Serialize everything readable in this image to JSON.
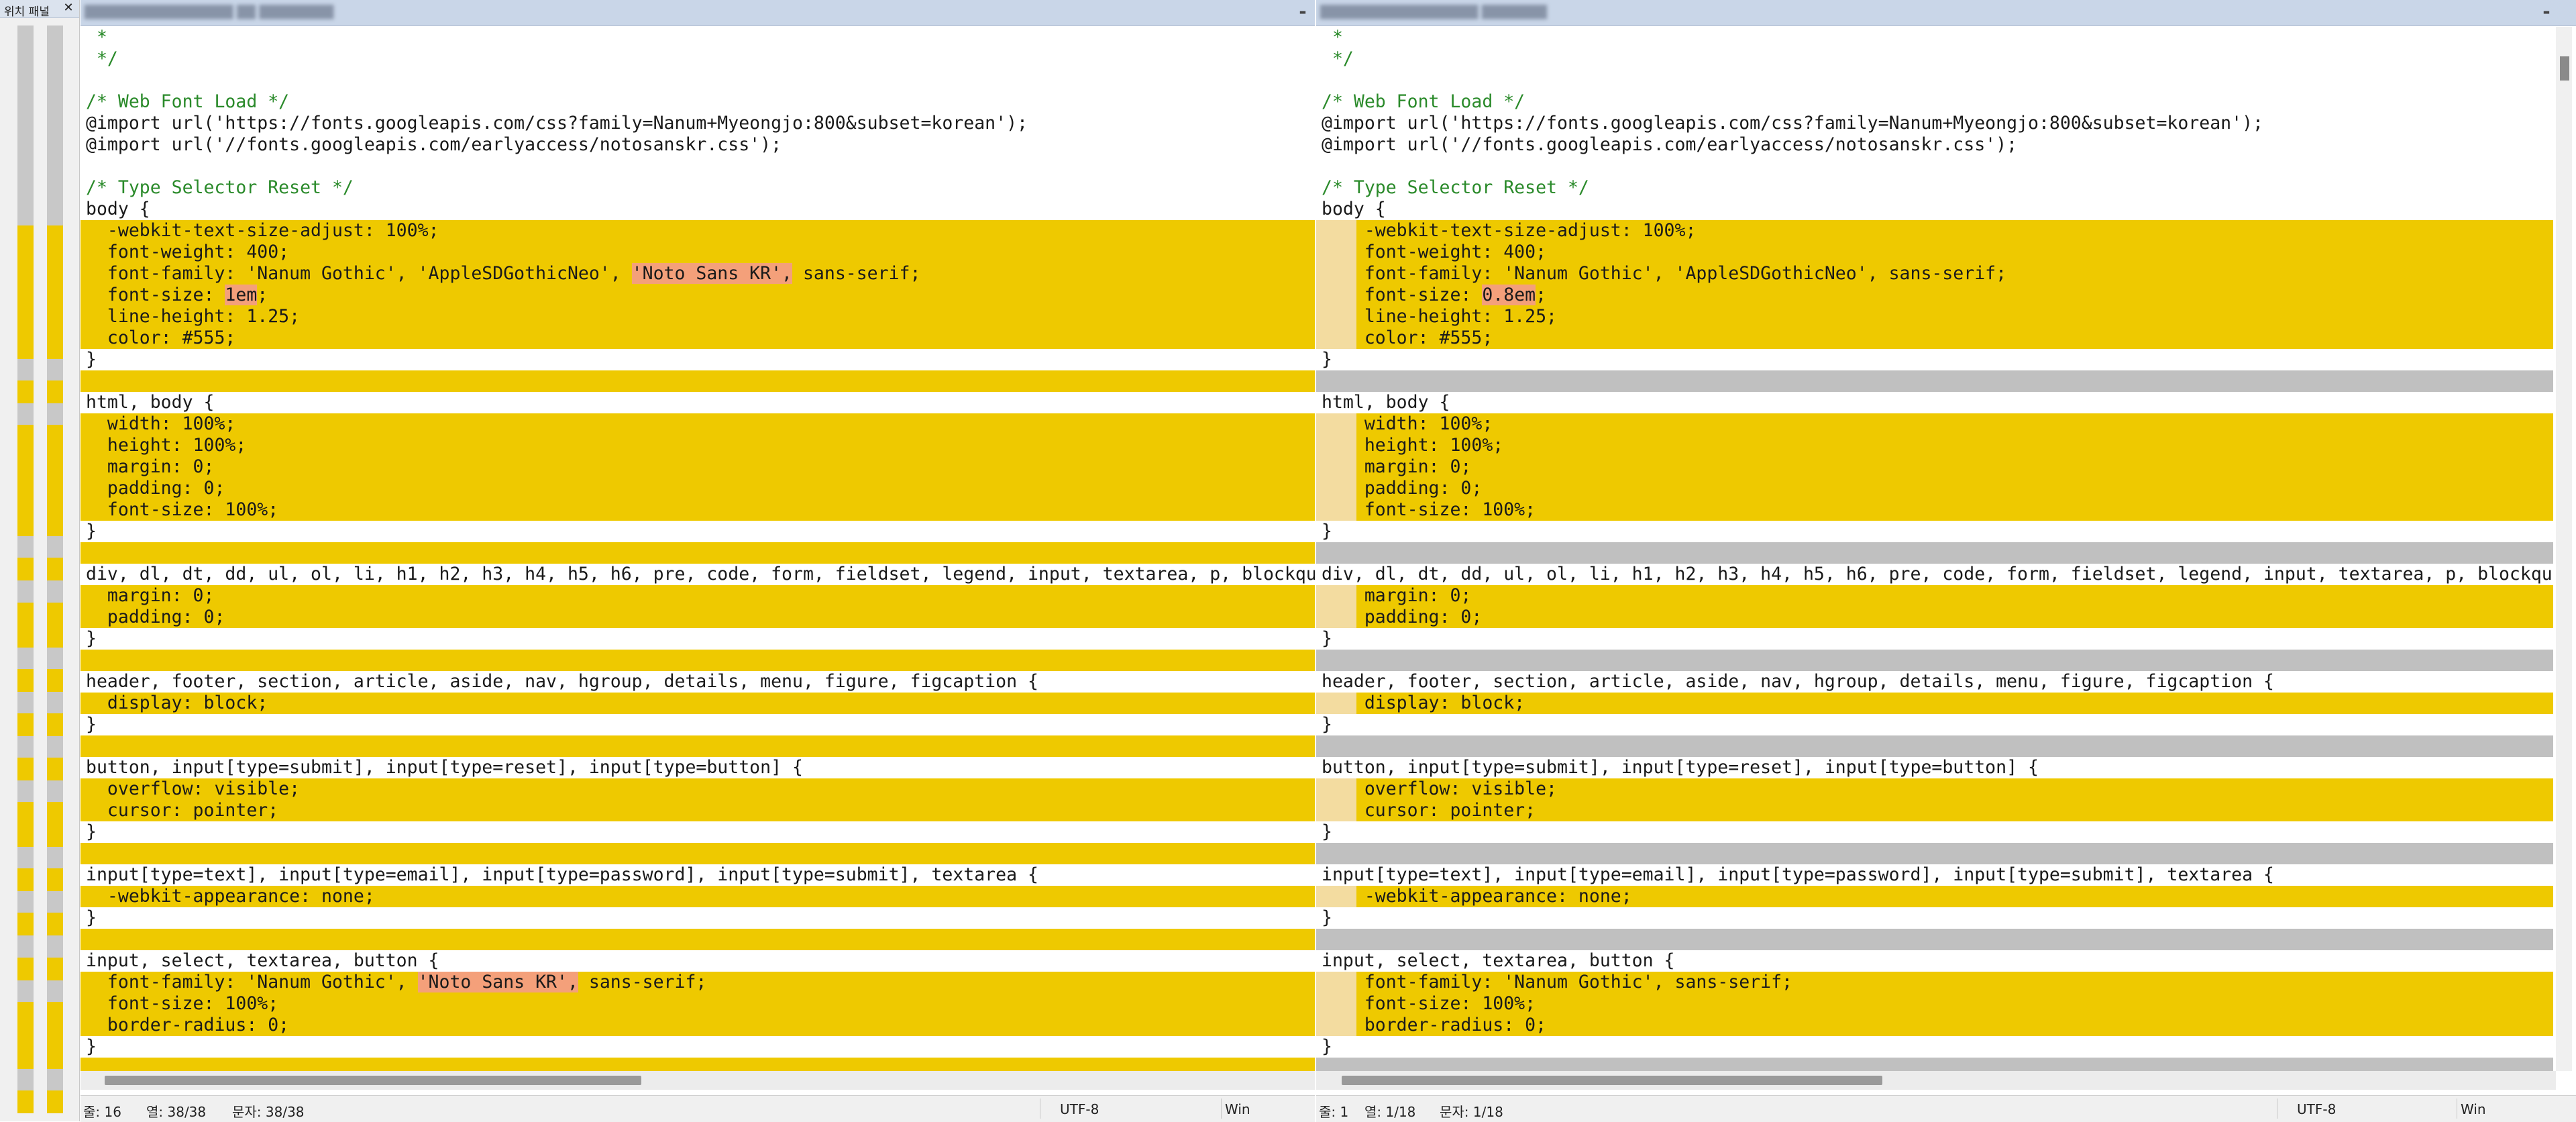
{
  "location_pane": {
    "tab_label": "위치 패널",
    "close_glyph": "✕",
    "mark_color": "#eec900"
  },
  "left_pane": {
    "title": "████████████████ ██ ████████",
    "lines": [
      {
        "type": "ctx",
        "cls": "comment",
        "segs": [
          {
            "t": " *"
          }
        ]
      },
      {
        "type": "ctx",
        "cls": "comment",
        "segs": [
          {
            "t": " */"
          }
        ]
      },
      {
        "type": "ctx",
        "segs": [
          {
            "t": ""
          }
        ]
      },
      {
        "type": "ctx",
        "cls": "comment",
        "segs": [
          {
            "t": "/* Web Font Load */"
          }
        ]
      },
      {
        "type": "ctx",
        "segs": [
          {
            "t": "@import url('https://fonts.googleapis.com/css?family=Nanum+Myeongjo:800&subset=korean');"
          }
        ]
      },
      {
        "type": "ctx",
        "segs": [
          {
            "t": "@import url('//fonts.googleapis.com/earlyaccess/notosanskr.css');"
          }
        ]
      },
      {
        "type": "ctx",
        "segs": [
          {
            "t": ""
          }
        ]
      },
      {
        "type": "ctx",
        "cls": "comment",
        "segs": [
          {
            "t": "/* Type Selector Reset */"
          }
        ]
      },
      {
        "type": "ctx",
        "segs": [
          {
            "t": "body {"
          }
        ]
      },
      {
        "type": "changed",
        "segs": [
          {
            "t": "  -webkit-text-size-adjust: 100%;"
          }
        ]
      },
      {
        "type": "changed",
        "segs": [
          {
            "t": "  font-weight: 400;"
          }
        ]
      },
      {
        "type": "changed",
        "segs": [
          {
            "t": "  font-family: 'Nanum Gothic', 'AppleSDGothicNeo', "
          },
          {
            "t": "'Noto Sans KR',",
            "hl": true
          },
          {
            "t": " sans-serif;"
          }
        ]
      },
      {
        "type": "changed",
        "segs": [
          {
            "t": "  font-size: "
          },
          {
            "t": "1em",
            "hl": true
          },
          {
            "t": ";"
          }
        ]
      },
      {
        "type": "changed",
        "segs": [
          {
            "t": "  line-height: 1.25;"
          }
        ]
      },
      {
        "type": "changed",
        "segs": [
          {
            "t": "  color: #555;"
          }
        ]
      },
      {
        "type": "ctx",
        "segs": [
          {
            "t": "}"
          }
        ]
      },
      {
        "type": "gap",
        "segs": [
          {
            "t": ""
          }
        ]
      },
      {
        "type": "ctx",
        "segs": [
          {
            "t": "html, body {"
          }
        ]
      },
      {
        "type": "changed",
        "segs": [
          {
            "t": "  width: 100%;"
          }
        ]
      },
      {
        "type": "changed",
        "segs": [
          {
            "t": "  height: 100%;"
          }
        ]
      },
      {
        "type": "changed",
        "segs": [
          {
            "t": "  margin: 0;"
          }
        ]
      },
      {
        "type": "changed",
        "segs": [
          {
            "t": "  padding: 0;"
          }
        ]
      },
      {
        "type": "changed",
        "segs": [
          {
            "t": "  font-size: 100%;"
          }
        ]
      },
      {
        "type": "ctx",
        "segs": [
          {
            "t": "}"
          }
        ]
      },
      {
        "type": "gap",
        "segs": [
          {
            "t": ""
          }
        ]
      },
      {
        "type": "ctx",
        "segs": [
          {
            "t": "div, dl, dt, dd, ul, ol, li, h1, h2, h3, h4, h5, h6, pre, code, form, fieldset, legend, input, textarea, p, blockquote"
          }
        ]
      },
      {
        "type": "changed",
        "segs": [
          {
            "t": "  margin: 0;"
          }
        ]
      },
      {
        "type": "changed",
        "segs": [
          {
            "t": "  padding: 0;"
          }
        ]
      },
      {
        "type": "ctx",
        "segs": [
          {
            "t": "}"
          }
        ]
      },
      {
        "type": "gap",
        "segs": [
          {
            "t": ""
          }
        ]
      },
      {
        "type": "ctx",
        "segs": [
          {
            "t": "header, footer, section, article, aside, nav, hgroup, details, menu, figure, figcaption {"
          }
        ]
      },
      {
        "type": "changed",
        "segs": [
          {
            "t": "  display: block;"
          }
        ]
      },
      {
        "type": "ctx",
        "segs": [
          {
            "t": "}"
          }
        ]
      },
      {
        "type": "gap",
        "segs": [
          {
            "t": ""
          }
        ]
      },
      {
        "type": "ctx",
        "segs": [
          {
            "t": "button, input[type=submit], input[type=reset], input[type=button] {"
          }
        ]
      },
      {
        "type": "changed",
        "segs": [
          {
            "t": "  overflow: visible;"
          }
        ]
      },
      {
        "type": "changed",
        "segs": [
          {
            "t": "  cursor: pointer;"
          }
        ]
      },
      {
        "type": "ctx",
        "segs": [
          {
            "t": "}"
          }
        ]
      },
      {
        "type": "gap",
        "segs": [
          {
            "t": ""
          }
        ]
      },
      {
        "type": "ctx",
        "segs": [
          {
            "t": "input[type=text], input[type=email], input[type=password], input[type=submit], textarea {"
          }
        ]
      },
      {
        "type": "changed",
        "segs": [
          {
            "t": "  -webkit-appearance: none;"
          }
        ]
      },
      {
        "type": "ctx",
        "segs": [
          {
            "t": "}"
          }
        ]
      },
      {
        "type": "gap",
        "segs": [
          {
            "t": ""
          }
        ]
      },
      {
        "type": "ctx",
        "segs": [
          {
            "t": "input, select, textarea, button {"
          }
        ]
      },
      {
        "type": "changed",
        "segs": [
          {
            "t": "  font-family: 'Nanum Gothic', "
          },
          {
            "t": "'Noto Sans KR',",
            "hl": true
          },
          {
            "t": " sans-serif;"
          }
        ]
      },
      {
        "type": "changed",
        "segs": [
          {
            "t": "  font-size: 100%;"
          }
        ]
      },
      {
        "type": "changed",
        "segs": [
          {
            "t": "  border-radius: 0;"
          }
        ]
      },
      {
        "type": "ctx",
        "segs": [
          {
            "t": "}"
          }
        ]
      },
      {
        "type": "gap",
        "segs": [
          {
            "t": ""
          }
        ]
      }
    ],
    "status": {
      "line": "줄: 16",
      "col": "열: 38/38",
      "chr": "문자: 38/38",
      "encoding": "UTF-8",
      "eol": "Win"
    }
  },
  "right_pane": {
    "title": "█████████████████ ███████",
    "lines": [
      {
        "type": "ctx",
        "cls": "comment",
        "segs": [
          {
            "t": " *"
          }
        ]
      },
      {
        "type": "ctx",
        "cls": "comment",
        "segs": [
          {
            "t": " */"
          }
        ]
      },
      {
        "type": "ctx",
        "segs": [
          {
            "t": ""
          }
        ]
      },
      {
        "type": "ctx",
        "cls": "comment",
        "segs": [
          {
            "t": "/* Web Font Load */"
          }
        ]
      },
      {
        "type": "ctx",
        "segs": [
          {
            "t": "@import url('https://fonts.googleapis.com/css?family=Nanum+Myeongjo:800&subset=korean');"
          }
        ]
      },
      {
        "type": "ctx",
        "segs": [
          {
            "t": "@import url('//fonts.googleapis.com/earlyaccess/notosanskr.css');"
          }
        ]
      },
      {
        "type": "ctx",
        "segs": [
          {
            "t": ""
          }
        ]
      },
      {
        "type": "ctx",
        "cls": "comment",
        "segs": [
          {
            "t": "/* Type Selector Reset */"
          }
        ]
      },
      {
        "type": "ctx",
        "segs": [
          {
            "t": "body {"
          }
        ]
      },
      {
        "type": "changed",
        "tint": true,
        "segs": [
          {
            "t": "    -webkit-text-size-adjust: 100%;"
          }
        ]
      },
      {
        "type": "changed",
        "tint": true,
        "segs": [
          {
            "t": "    font-weight: 400;"
          }
        ]
      },
      {
        "type": "changed",
        "tint": true,
        "segs": [
          {
            "t": "    font-family: 'Nanum Gothic', 'AppleSDGothicNeo', sans-serif;"
          }
        ]
      },
      {
        "type": "changed",
        "tint": true,
        "segs": [
          {
            "t": "    font-size: "
          },
          {
            "t": "0.8em",
            "hl": true
          },
          {
            "t": ";"
          }
        ]
      },
      {
        "type": "changed",
        "tint": true,
        "segs": [
          {
            "t": "    line-height: 1.25;"
          }
        ]
      },
      {
        "type": "changed",
        "tint": true,
        "segs": [
          {
            "t": "    color: #555;"
          }
        ]
      },
      {
        "type": "ctx",
        "segs": [
          {
            "t": "}"
          }
        ]
      },
      {
        "type": "gapgray",
        "segs": [
          {
            "t": ""
          }
        ]
      },
      {
        "type": "ctx",
        "segs": [
          {
            "t": "html, body {"
          }
        ]
      },
      {
        "type": "changed",
        "tint": true,
        "segs": [
          {
            "t": "    width: 100%;"
          }
        ]
      },
      {
        "type": "changed",
        "tint": true,
        "segs": [
          {
            "t": "    height: 100%;"
          }
        ]
      },
      {
        "type": "changed",
        "tint": true,
        "segs": [
          {
            "t": "    margin: 0;"
          }
        ]
      },
      {
        "type": "changed",
        "tint": true,
        "segs": [
          {
            "t": "    padding: 0;"
          }
        ]
      },
      {
        "type": "changed",
        "tint": true,
        "segs": [
          {
            "t": "    font-size: 100%;"
          }
        ]
      },
      {
        "type": "ctx",
        "segs": [
          {
            "t": "}"
          }
        ]
      },
      {
        "type": "gapgray",
        "segs": [
          {
            "t": ""
          }
        ]
      },
      {
        "type": "ctx",
        "segs": [
          {
            "t": "div, dl, dt, dd, ul, ol, li, h1, h2, h3, h4, h5, h6, pre, code, form, fieldset, legend, input, textarea, p, blockquote"
          }
        ]
      },
      {
        "type": "changed",
        "tint": true,
        "segs": [
          {
            "t": "    margin: 0;"
          }
        ]
      },
      {
        "type": "changed",
        "tint": true,
        "segs": [
          {
            "t": "    padding: 0;"
          }
        ]
      },
      {
        "type": "ctx",
        "segs": [
          {
            "t": "}"
          }
        ]
      },
      {
        "type": "gapgray",
        "segs": [
          {
            "t": ""
          }
        ]
      },
      {
        "type": "ctx",
        "segs": [
          {
            "t": "header, footer, section, article, aside, nav, hgroup, details, menu, figure, figcaption {"
          }
        ]
      },
      {
        "type": "changed",
        "tint": true,
        "segs": [
          {
            "t": "    display: block;"
          }
        ]
      },
      {
        "type": "ctx",
        "segs": [
          {
            "t": "}"
          }
        ]
      },
      {
        "type": "gapgray",
        "segs": [
          {
            "t": ""
          }
        ]
      },
      {
        "type": "ctx",
        "segs": [
          {
            "t": "button, input[type=submit], input[type=reset], input[type=button] {"
          }
        ]
      },
      {
        "type": "changed",
        "tint": true,
        "segs": [
          {
            "t": "    overflow: visible;"
          }
        ]
      },
      {
        "type": "changed",
        "tint": true,
        "segs": [
          {
            "t": "    cursor: pointer;"
          }
        ]
      },
      {
        "type": "ctx",
        "segs": [
          {
            "t": "}"
          }
        ]
      },
      {
        "type": "gapgray",
        "segs": [
          {
            "t": ""
          }
        ]
      },
      {
        "type": "ctx",
        "segs": [
          {
            "t": "input[type=text], input[type=email], input[type=password], input[type=submit], textarea {"
          }
        ]
      },
      {
        "type": "changed",
        "tint": true,
        "segs": [
          {
            "t": "    -webkit-appearance: none;"
          }
        ]
      },
      {
        "type": "ctx",
        "segs": [
          {
            "t": "}"
          }
        ]
      },
      {
        "type": "gapgray",
        "segs": [
          {
            "t": ""
          }
        ]
      },
      {
        "type": "ctx",
        "segs": [
          {
            "t": "input, select, textarea, button {"
          }
        ]
      },
      {
        "type": "changed",
        "tint": true,
        "segs": [
          {
            "t": "    font-family: 'Nanum Gothic', sans-serif;"
          }
        ]
      },
      {
        "type": "changed",
        "tint": true,
        "segs": [
          {
            "t": "    font-size: 100%;"
          }
        ]
      },
      {
        "type": "changed",
        "tint": true,
        "segs": [
          {
            "t": "    border-radius: 0;"
          }
        ]
      },
      {
        "type": "ctx",
        "segs": [
          {
            "t": "}"
          }
        ]
      },
      {
        "type": "gapgray",
        "segs": [
          {
            "t": ""
          }
        ]
      }
    ],
    "status": {
      "line": "줄: 1",
      "col": "열: 1/18",
      "chr": "문자: 1/18",
      "encoding": "UTF-8",
      "eol": "Win"
    }
  },
  "colors": {
    "changed": "#eec900",
    "highlight": "#f4a07a",
    "gap_gray": "#c0c0c0",
    "comment": "#2a8a2a"
  },
  "icons": {
    "close": "close-icon",
    "pane_max": "maximize-icon"
  }
}
